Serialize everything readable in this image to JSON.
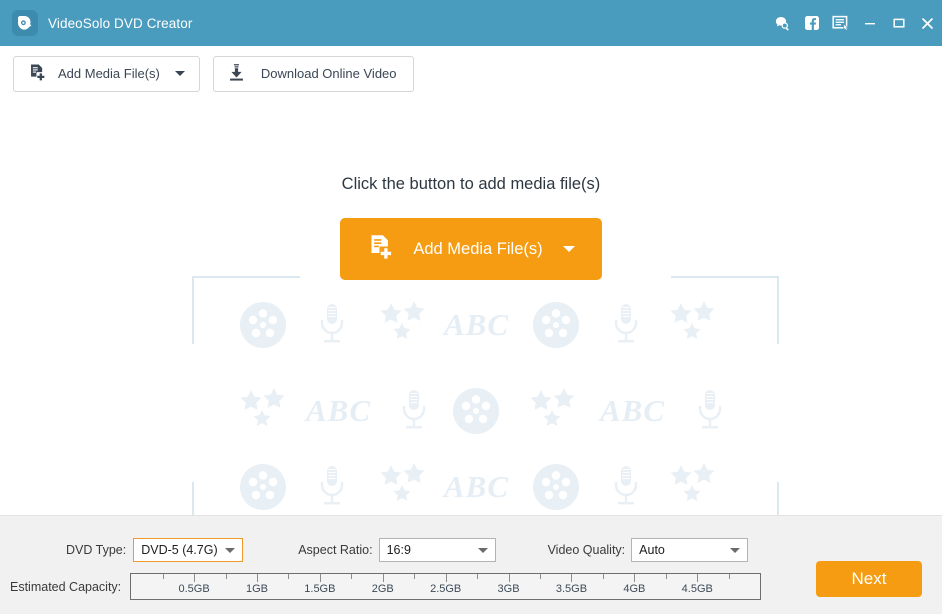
{
  "window": {
    "title": "VideoSolo DVD Creator",
    "logo_icon": "videosolo-logo-icon",
    "actions": [
      {
        "name": "feedback-icon",
        "icon": "speech-bubble-search-icon"
      },
      {
        "name": "facebook-icon",
        "icon": "facebook-icon"
      },
      {
        "name": "menu-icon",
        "icon": "list-cursor-icon"
      }
    ],
    "controls": {
      "minimize": "–",
      "maximize": "☐",
      "close": "✕"
    }
  },
  "toolbar": {
    "add_media_label": "Add Media File(s)",
    "add_media_icon": "file-add-icon",
    "download_label": "Download Online Video",
    "download_icon": "download-icon"
  },
  "dropzone": {
    "hint": "Click the button to add media file(s)",
    "add_button_label": "Add Media File(s)",
    "add_button_icon": "file-add-icon",
    "watermark_icons": [
      "film-reel-icon",
      "microphone-icon",
      "stars-icon",
      "abc-text"
    ],
    "watermark_text": "ABC",
    "accent_color": "#f59c12",
    "watermark_color": "#e8eff5",
    "bracket_color": "#dce8f0"
  },
  "settings": {
    "dvd_type_label": "DVD Type:",
    "dvd_type_value": "DVD-5 (4.7G)",
    "aspect_ratio_label": "Aspect Ratio:",
    "aspect_ratio_value": "16:9",
    "video_quality_label": "Video Quality:",
    "video_quality_value": "Auto"
  },
  "capacity": {
    "label": "Estimated Capacity:",
    "ticks": [
      "0.5GB",
      "1GB",
      "1.5GB",
      "2GB",
      "2.5GB",
      "3GB",
      "3.5GB",
      "4GB",
      "4.5GB"
    ],
    "max_gb": 5,
    "used_gb": 0
  },
  "footer": {
    "next_label": "Next"
  },
  "colors": {
    "titlebar": "#4a9cbf",
    "accent": "#f59c12",
    "panel": "#f1f1f1"
  }
}
